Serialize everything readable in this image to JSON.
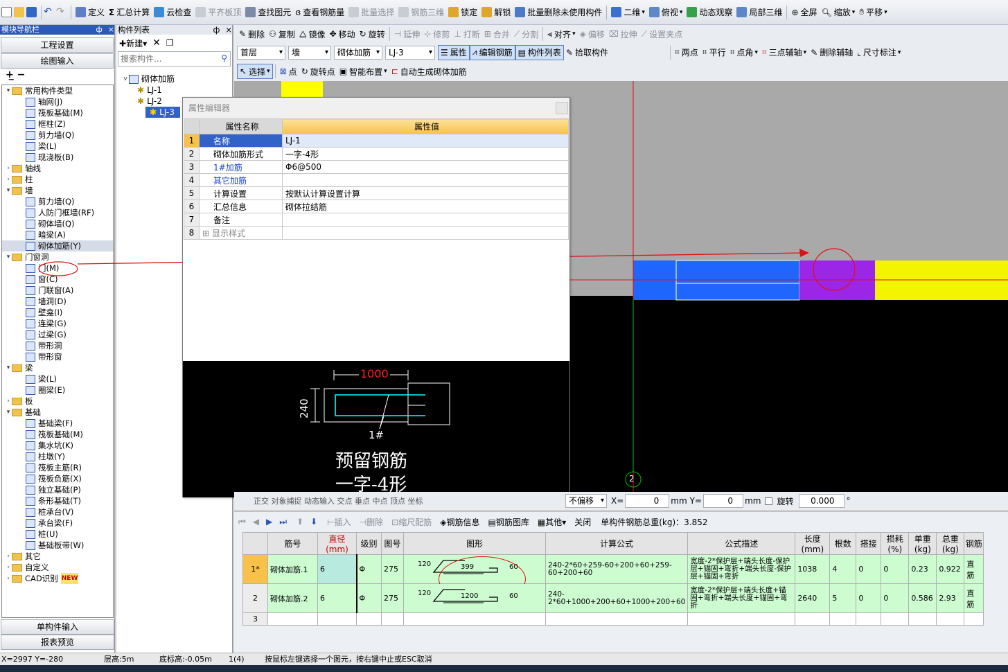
{
  "toolbar1": {
    "items": [
      "定义",
      "汇总计算",
      "云检查",
      "平齐板顶",
      "查找图元",
      "查看钢筋量",
      "批量选择",
      "钢筋三维",
      "锁定",
      "解锁",
      "批量删除未使用构件",
      "二维",
      "俯视",
      "动态观察",
      "局部三维",
      "全屏",
      "缩放",
      "平移"
    ]
  },
  "nav": {
    "title": "模块导航栏",
    "pin": "ф",
    "close": "×",
    "buttons": [
      "工程设置",
      "绘图输入",
      "单构件输入",
      "报表预览"
    ],
    "tree": [
      {
        "label": "常用构件类型",
        "level": 0,
        "type": "folder",
        "exp": "v"
      },
      {
        "label": "轴网(J)",
        "level": 1,
        "type": "item"
      },
      {
        "label": "筏板基础(M)",
        "level": 1,
        "type": "item"
      },
      {
        "label": "框柱(Z)",
        "level": 1,
        "type": "item"
      },
      {
        "label": "剪力墙(Q)",
        "level": 1,
        "type": "item"
      },
      {
        "label": "梁(L)",
        "level": 1,
        "type": "item"
      },
      {
        "label": "现浇板(B)",
        "level": 1,
        "type": "item"
      },
      {
        "label": "轴线",
        "level": 0,
        "type": "folder",
        "exp": ">"
      },
      {
        "label": "柱",
        "level": 0,
        "type": "folder",
        "exp": ">"
      },
      {
        "label": "墙",
        "level": 0,
        "type": "folder",
        "exp": "v"
      },
      {
        "label": "剪力墙(Q)",
        "level": 1,
        "type": "item"
      },
      {
        "label": "人防门框墙(RF)",
        "level": 1,
        "type": "item"
      },
      {
        "label": "砌体墙(Q)",
        "level": 1,
        "type": "item"
      },
      {
        "label": "暗梁(A)",
        "level": 1,
        "type": "item"
      },
      {
        "label": "砌体加筋(Y)",
        "level": 1,
        "type": "item",
        "selected": true
      },
      {
        "label": "门窗洞",
        "level": 0,
        "type": "folder",
        "exp": "v"
      },
      {
        "label": "门(M)",
        "level": 1,
        "type": "item"
      },
      {
        "label": "窗(C)",
        "level": 1,
        "type": "item"
      },
      {
        "label": "门联窗(A)",
        "level": 1,
        "type": "item"
      },
      {
        "label": "墙洞(D)",
        "level": 1,
        "type": "item"
      },
      {
        "label": "壁龛(I)",
        "level": 1,
        "type": "item"
      },
      {
        "label": "连梁(G)",
        "level": 1,
        "type": "item"
      },
      {
        "label": "过梁(G)",
        "level": 1,
        "type": "item"
      },
      {
        "label": "带形洞",
        "level": 1,
        "type": "item"
      },
      {
        "label": "带形窗",
        "level": 1,
        "type": "item"
      },
      {
        "label": "梁",
        "level": 0,
        "type": "folder",
        "exp": "v"
      },
      {
        "label": "梁(L)",
        "level": 1,
        "type": "item"
      },
      {
        "label": "圈梁(E)",
        "level": 1,
        "type": "item"
      },
      {
        "label": "板",
        "level": 0,
        "type": "folder",
        "exp": ">"
      },
      {
        "label": "基础",
        "level": 0,
        "type": "folder",
        "exp": "v"
      },
      {
        "label": "基础梁(F)",
        "level": 1,
        "type": "item"
      },
      {
        "label": "筏板基础(M)",
        "level": 1,
        "type": "item"
      },
      {
        "label": "集水坑(K)",
        "level": 1,
        "type": "item"
      },
      {
        "label": "柱墩(Y)",
        "level": 1,
        "type": "item"
      },
      {
        "label": "筏板主筋(R)",
        "level": 1,
        "type": "item"
      },
      {
        "label": "筏板负筋(X)",
        "level": 1,
        "type": "item"
      },
      {
        "label": "独立基础(P)",
        "level": 1,
        "type": "item"
      },
      {
        "label": "条形基础(T)",
        "level": 1,
        "type": "item"
      },
      {
        "label": "桩承台(V)",
        "level": 1,
        "type": "item"
      },
      {
        "label": "承台梁(F)",
        "level": 1,
        "type": "item"
      },
      {
        "label": "桩(U)",
        "level": 1,
        "type": "item"
      },
      {
        "label": "基础板带(W)",
        "level": 1,
        "type": "item"
      },
      {
        "label": "其它",
        "level": 0,
        "type": "folder",
        "exp": ">"
      },
      {
        "label": "自定义",
        "level": 0,
        "type": "folder",
        "exp": ">"
      },
      {
        "label": "CAD识别",
        "level": 0,
        "type": "folder",
        "exp": ">",
        "badge": "NEW"
      }
    ]
  },
  "clist": {
    "title": "构件列表",
    "new_label": "新建",
    "search_placeholder": "搜索构件...",
    "root": "砌体加筋",
    "items": [
      "LJ-1",
      "LJ-2",
      "LJ-3"
    ],
    "selected": "LJ-3"
  },
  "tb2": [
    "删除",
    "复制",
    "镜像",
    "移动",
    "旋转",
    "延伸",
    "修剪",
    "打断",
    "合并",
    "分割",
    "对齐",
    "偏移",
    "拉伸",
    "设置夹点"
  ],
  "tb3": {
    "floor": "首层",
    "category": "墙",
    "type": "砌体加筋",
    "name": "LJ-3",
    "buttons": [
      "属性",
      "编辑钢筋",
      "构件列表",
      "拾取构件"
    ],
    "right": [
      "两点",
      "平行",
      "点角",
      "三点辅轴",
      "删除辅轴",
      "尺寸标注"
    ]
  },
  "tb4": [
    "选择",
    "点",
    "旋转点",
    "智能布置",
    "自动生成砌体加筋"
  ],
  "dialog": {
    "title": "属性编辑器",
    "col_name": "属性名称",
    "col_value": "属性值",
    "rows": [
      {
        "n": "1",
        "name": "名称",
        "value": "LJ-1"
      },
      {
        "n": "2",
        "name": "砌体加筋形式",
        "value": "一字-4形"
      },
      {
        "n": "3",
        "name": "1#加筋",
        "value": "Φ6@500"
      },
      {
        "n": "4",
        "name": "其它加筋",
        "value": ""
      },
      {
        "n": "5",
        "name": "计算设置",
        "value": "按默认计算设置计算"
      },
      {
        "n": "6",
        "name": "汇总信息",
        "value": "砌体拉结筋"
      },
      {
        "n": "7",
        "name": "备注",
        "value": ""
      },
      {
        "n": "8",
        "name": "显示样式",
        "value": ""
      }
    ],
    "preview": {
      "dim_len": "1000",
      "dim_w": "240",
      "bar_label": "1#",
      "caption1": "预留钢筋",
      "caption2": "一字-4形"
    }
  },
  "canvas": {
    "axis_label": "2"
  },
  "coord": {
    "ghost": "正交 对象捕捉 动态输入 交点 垂点 中点 顶点 坐标",
    "offset_mode": "不偏移",
    "x_label": "X=",
    "x_value": "0",
    "y_label": "Y=",
    "y_value": "0",
    "unit": "mm",
    "rotate_label": "旋转",
    "rotate_value": "0.000",
    "deg": "°"
  },
  "rebar": {
    "toolbar": [
      "插入",
      "删除",
      "缩尺配筋",
      "钢筋信息",
      "钢筋图库",
      "其他",
      "关闭"
    ],
    "total": "单构件钢筋总重(kg)：3.852",
    "headers": [
      "筋号",
      "直径(mm)",
      "级别",
      "图号",
      "图形",
      "计算公式",
      "公式描述",
      "长度(mm)",
      "根数",
      "搭接",
      "损耗(%)",
      "单重(kg)",
      "总重(kg)",
      "钢筋"
    ],
    "rows": [
      {
        "idx": "1*",
        "name": "砌体加筋.1",
        "dia": "6",
        "grade": "Φ",
        "fig": "275",
        "left": "120",
        "mid": "399",
        "right": "60",
        "formula": "240-2*60+259-60+200+60+259-60+200+60",
        "desc": "宽度-2*保护层+端头长度-保护层+锚固+弯折+端头长度-保护层+锚固+弯折",
        "len": "1038",
        "count": "4",
        "lap": "0",
        "loss": "0",
        "unit": "0.23",
        "total": "0.922",
        "type": "直筋"
      },
      {
        "idx": "2",
        "name": "砌体加筋.2",
        "dia": "6",
        "grade": "Φ",
        "fig": "275",
        "left": "120",
        "mid": "1200",
        "right": "60",
        "formula": "240-2*60+1000+200+60+1000+200+60",
        "desc": "宽度-2*保护层+端头长度+锚固+弯折+端头长度+锚固+弯折",
        "len": "2640",
        "count": "5",
        "lap": "0",
        "loss": "0",
        "unit": "0.586",
        "total": "2.93",
        "type": "直筋"
      },
      {
        "idx": "3"
      }
    ]
  },
  "status": {
    "coords": "X=2997 Y=-280",
    "floor_h": "层高:5m",
    "base_h": "底标高:-0.05m",
    "count": "1(4)",
    "hint": "按鼠标左键选择一个图元，按右键中止或ESC取消"
  }
}
